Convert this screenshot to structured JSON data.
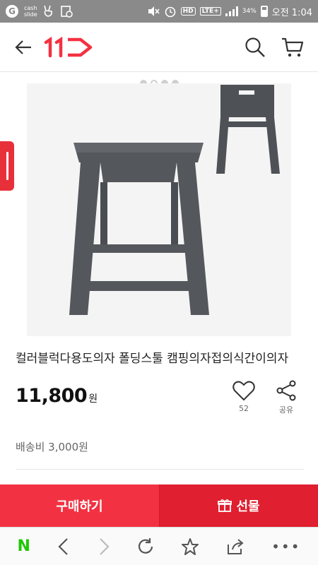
{
  "status_bar": {
    "cash_logo": "G",
    "cash_line1": "cash",
    "cash_line2": "slide",
    "lte": "LTE+",
    "hd": "HD",
    "battery": "34%",
    "time": "오전 1:04"
  },
  "header": {
    "logo_text": "11",
    "back_icon": "arrow-left-icon",
    "search_icon": "search-icon",
    "cart_icon": "cart-icon"
  },
  "carousel": {
    "total": 4,
    "active_index": 1
  },
  "product": {
    "title": "컬러블럭다용도의자 폴딩스툴 캠핑의자접의식간이의자",
    "price": "11,800",
    "price_unit": "원",
    "likes": "52",
    "share_label": "공유",
    "shipping": "배송비 3,000원"
  },
  "actions": {
    "buy_label": "구매하기",
    "gift_label": "선물"
  },
  "browser_bar": {
    "home": "N",
    "more": "•••"
  },
  "colors": {
    "brand_red": "#f23242",
    "naver_green": "#1ec800"
  }
}
